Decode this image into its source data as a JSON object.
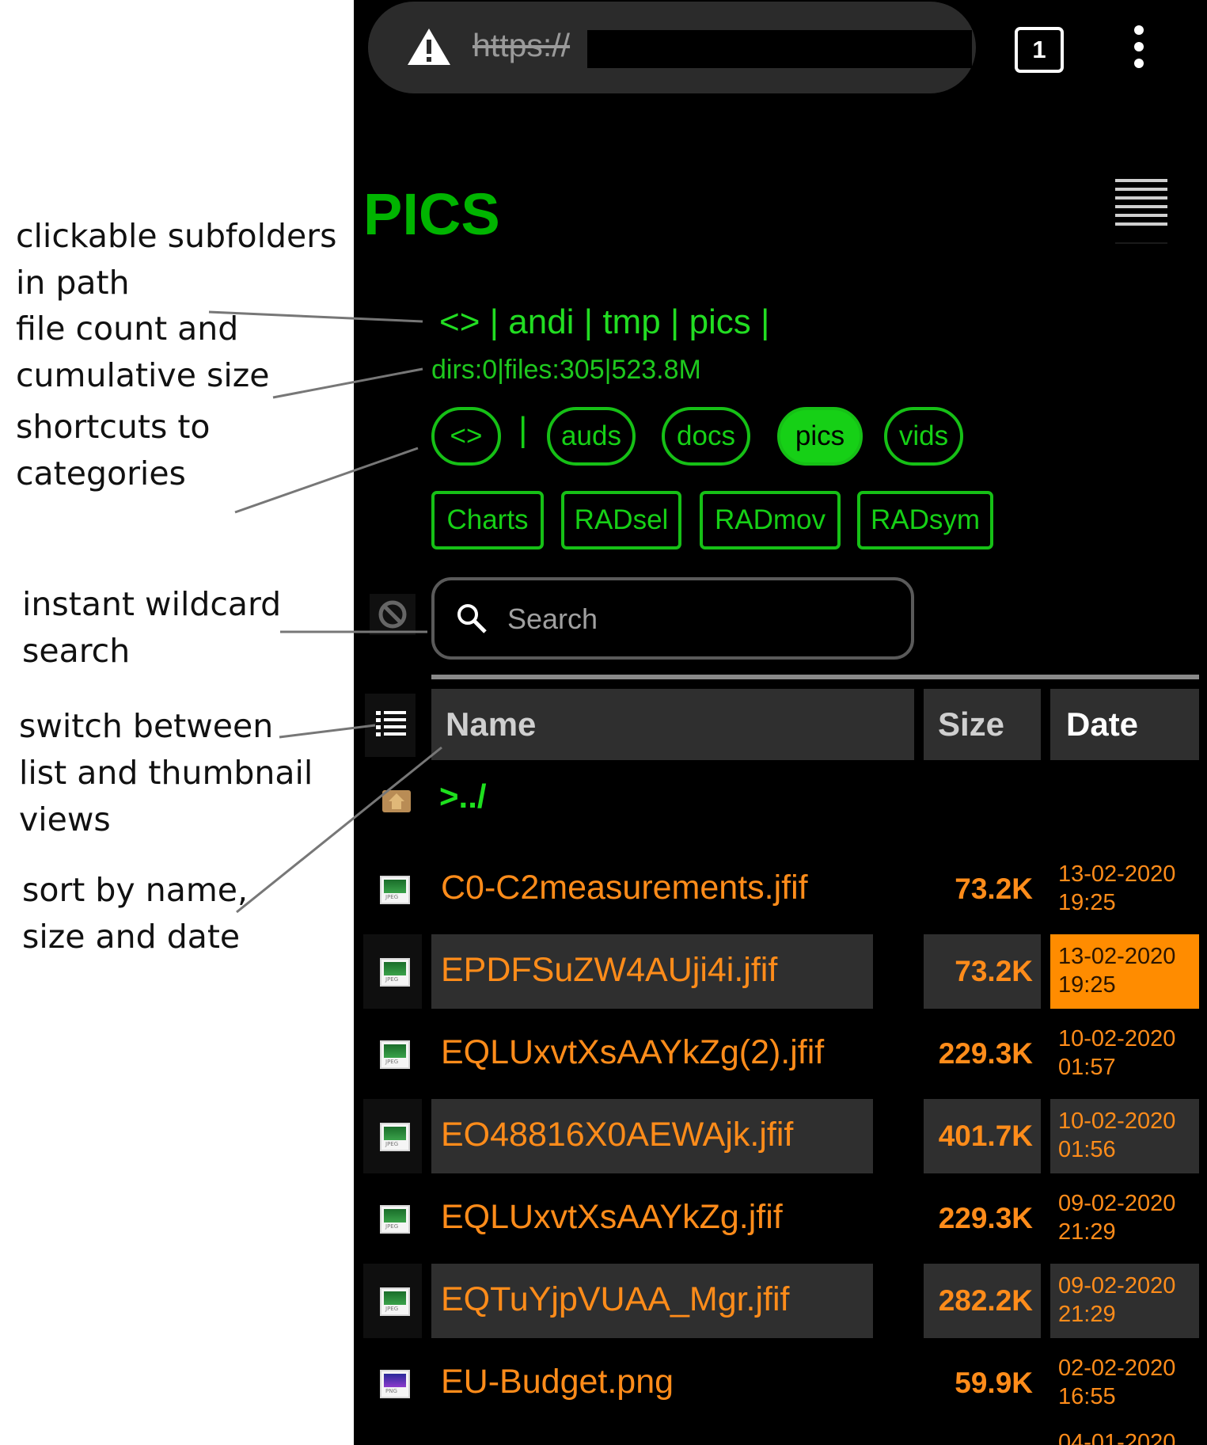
{
  "annotations": [
    {
      "id": "subfolders",
      "text": "clickable subfolders\nin path"
    },
    {
      "id": "filecount",
      "text": "file count and\ncumulative size"
    },
    {
      "id": "shortcuts",
      "text": "shortcuts to\ncategories"
    },
    {
      "id": "search",
      "text": "instant wildcard\nsearch"
    },
    {
      "id": "switch",
      "text": "switch between\nlist and thumbnail\nviews"
    },
    {
      "id": "sort",
      "text": "sort by name,\nsize and date"
    }
  ],
  "browser": {
    "url": "https://",
    "tab_count": "1"
  },
  "page": {
    "title": "PICS",
    "breadcrumb": "<> | andi | tmp | pics |",
    "stats": "dirs:0|files:305|523.8M",
    "categories": [
      {
        "label": "<>",
        "active": false
      },
      {
        "label": "auds",
        "active": false
      },
      {
        "label": "docs",
        "active": false
      },
      {
        "label": "pics",
        "active": true
      },
      {
        "label": "vids",
        "active": false
      }
    ],
    "category_separator": "|",
    "shortcuts": [
      "Charts",
      "RADsel",
      "RADmov",
      "RADsym"
    ],
    "search_placeholder": "Search"
  },
  "table": {
    "columns": {
      "name": "Name",
      "size": "Size",
      "date": "Date"
    },
    "parent_link": ">../",
    "rows": [
      {
        "name": "C0-C2measurements.jfif",
        "size": "73.2K",
        "date": "13-02-2020\n19:25",
        "icon": "jpeg-file-icon"
      },
      {
        "name": "EPDFSuZW4AUji4i.jfif",
        "size": "73.2K",
        "date": "13-02-2020\n19:25",
        "icon": "jpeg-file-icon",
        "highlight": true
      },
      {
        "name": "EQLUxvtXsAAYkZg(2).jfif",
        "size": "229.3K",
        "date": "10-02-2020\n01:57",
        "icon": "jpeg-file-icon"
      },
      {
        "name": "EO48816X0AEWAjk.jfif",
        "size": "401.7K",
        "date": "10-02-2020\n01:56",
        "icon": "jpeg-file-icon"
      },
      {
        "name": "EQLUxvtXsAAYkZg.jfif",
        "size": "229.3K",
        "date": "09-02-2020\n21:29",
        "icon": "jpeg-file-icon"
      },
      {
        "name": "EQTuYjpVUAA_Mgr.jfif",
        "size": "282.2K",
        "date": "09-02-2020\n21:29",
        "icon": "jpeg-file-icon"
      },
      {
        "name": "EU-Budget.png",
        "size": "59.9K",
        "date": "02-02-2020\n16:55",
        "icon": "png-file-icon"
      }
    ],
    "partial_next_date": "04-01-2020"
  },
  "colors": {
    "accent_green": "#16d016",
    "file_orange": "#ff8c1a",
    "highlight_orange": "#ff8c00",
    "background": "#000000"
  }
}
